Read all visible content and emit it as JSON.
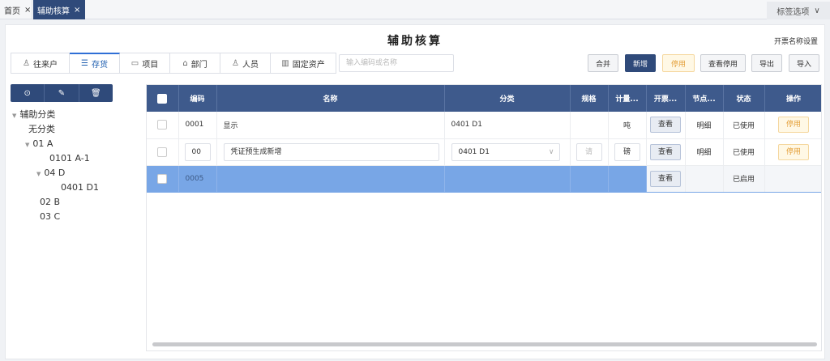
{
  "tabs": {
    "home": "首页",
    "active": "辅助核算",
    "close": "×",
    "tag_options": "标签选项",
    "tag_options_chevron": "∨"
  },
  "page": {
    "title": "辅助核算",
    "name_setting": "开票名称设置"
  },
  "category_tabs": [
    {
      "label": "往来户",
      "icon": "person-icon",
      "glyph": "♙"
    },
    {
      "label": "存货",
      "icon": "inventory-icon",
      "glyph": "☰"
    },
    {
      "label": "项目",
      "icon": "folder-icon",
      "glyph": "▭"
    },
    {
      "label": "部门",
      "icon": "department-icon",
      "glyph": "⌂"
    },
    {
      "label": "人员",
      "icon": "person-icon",
      "glyph": "♙"
    },
    {
      "label": "固定资产",
      "icon": "asset-icon",
      "glyph": "▥"
    }
  ],
  "search": {
    "placeholder": "输入编码或名称",
    "value": ""
  },
  "toolbar": {
    "merge": "合并",
    "add": "新增",
    "disable": "停用",
    "view_disabled": "查看停用",
    "export": "导出",
    "import": "导入"
  },
  "tree_toolbar": {
    "add_glyph": "⊙",
    "edit_glyph": "✎",
    "delete_glyph": "🗑"
  },
  "tree": {
    "root": "辅助分类",
    "uncategorized": "无分类",
    "n01": "01 A",
    "n0101": "0101 A-1",
    "n04": "04 D",
    "n0401": "0401 D1",
    "n02": "02 B",
    "n03": "03 C"
  },
  "table": {
    "headers": {
      "code": "编码",
      "name": "名称",
      "category": "分类",
      "spec": "规格",
      "unit": "计量...",
      "invoice": "开票...",
      "node": "节点...",
      "status": "状态",
      "action": "操作"
    },
    "row1": {
      "code": "0001",
      "name": "显示",
      "category": "0401 D1",
      "spec": "",
      "unit": "吨",
      "invoice": "查看",
      "node": "明细",
      "status": "已使用",
      "action": "停用"
    },
    "row2": {
      "code": "00",
      "name": "凭证预生成新增",
      "category": "0401 D1",
      "spec_placeholder": "请",
      "unit": "磅",
      "invoice": "查看",
      "node": "明细",
      "status": "已使用",
      "action": "停用"
    },
    "row3": {
      "code": "0005",
      "invoice": "查看",
      "status": "已启用"
    }
  }
}
